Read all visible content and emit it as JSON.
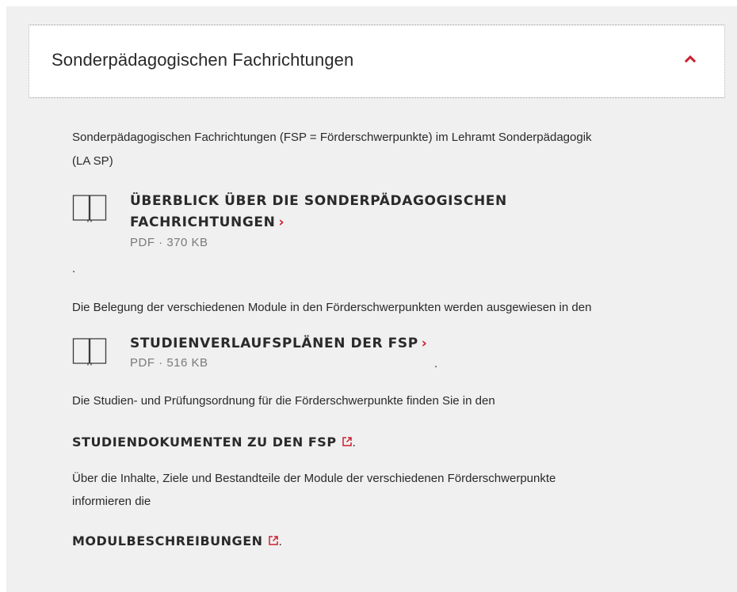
{
  "accordion": {
    "title": "Sonderpädagogischen Fachrichtungen",
    "expanded": true,
    "toggle_icon": "chevron-up-icon"
  },
  "content": {
    "intro_line1": "Sonderpädagogischen Fachrichtungen (FSP = Förderschwerpunkte) im Lehramt Sonderpädagogik",
    "intro_line2": "(LA SP)",
    "doc1": {
      "title_line1": "ÜBERBLICK ÜBER DIE SONDERPÄDAGOGISCHEN",
      "title_line2": "FACHRICHTUNGEN",
      "arrow": "›",
      "meta": "PDF · 370 KB",
      "icon": "book-icon"
    },
    "stray_dot1": ".",
    "belegung_text": "Die Belegung der verschiedenen Module in den Förderschwerpunkten werden ausgewiesen in den",
    "doc2": {
      "title": "STUDIENVERLAUFSPLÄNEN DER FSP",
      "arrow": "›",
      "meta": "PDF · 516 KB",
      "icon": "book-icon"
    },
    "stray_dot2": ".",
    "pruefung_text": "Die Studien- und Prüfungsordnung für die Förderschwerpunkte finden Sie in den",
    "link1": {
      "label": "STUDIENDOKUMENTEN ZU DEN FSP",
      "suffix": ".",
      "icon": "external-link-icon"
    },
    "inhalte_line1": "Über die Inhalte, Ziele und Bestandteile der Module der verschiedenen Förderschwerpunkte",
    "inhalte_line2": "informieren die",
    "link2": {
      "label": "MODULBESCHREIBUNGEN",
      "suffix": ".",
      "icon": "external-link-icon"
    }
  },
  "colors": {
    "accent": "#cc1f2f",
    "background": "#f0f0f0",
    "text": "#2a2a2a",
    "meta": "#7a7a7a"
  }
}
